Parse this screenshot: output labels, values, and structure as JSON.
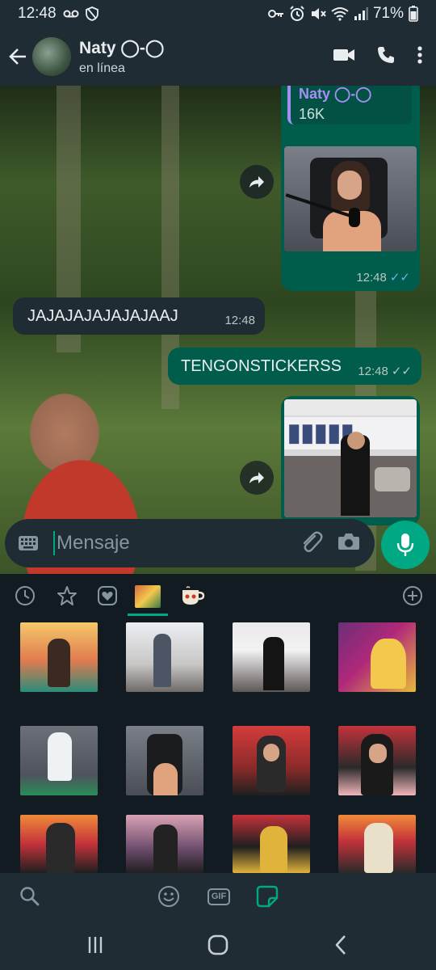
{
  "status_bar": {
    "time": "12:48",
    "battery": "71%",
    "icons": [
      "voicemail-icon",
      "shield-icon",
      "key-icon",
      "alarm-icon",
      "mute-icon",
      "wifi-icon",
      "signal-icon",
      "battery-icon"
    ]
  },
  "header": {
    "contact_name": "Naty ◯-◯",
    "contact_status": "en línea",
    "actions": [
      "video-call-icon",
      "voice-call-icon",
      "more-icon"
    ]
  },
  "messages": [
    {
      "type": "media_out",
      "quote_name": "Naty ◯-◯",
      "quote_text": "16K",
      "time": "12:48",
      "status": "read"
    },
    {
      "type": "text_in",
      "text": "JAJAJAJAJAJAJAAJ",
      "time": "12:48"
    },
    {
      "type": "text_out",
      "text": "TENGONSTICKERSS",
      "time": "12:48",
      "status": "delivered"
    },
    {
      "type": "media_out_partial"
    }
  ],
  "input": {
    "placeholder": "Mensaje"
  },
  "sticker_tabs": [
    "recent-icon",
    "favorite-icon",
    "heart-pack-icon",
    "sticker-pack-1",
    "sticker-pack-2",
    "add-icon"
  ],
  "emoji_bar": {
    "gif_label": "GIF"
  },
  "colors": {
    "accent": "#00a884",
    "bubble_out": "#005c4b",
    "bubble_in": "#1f2c34",
    "bar_bg": "#1f2c34",
    "read_ticks": "#53bdeb"
  }
}
